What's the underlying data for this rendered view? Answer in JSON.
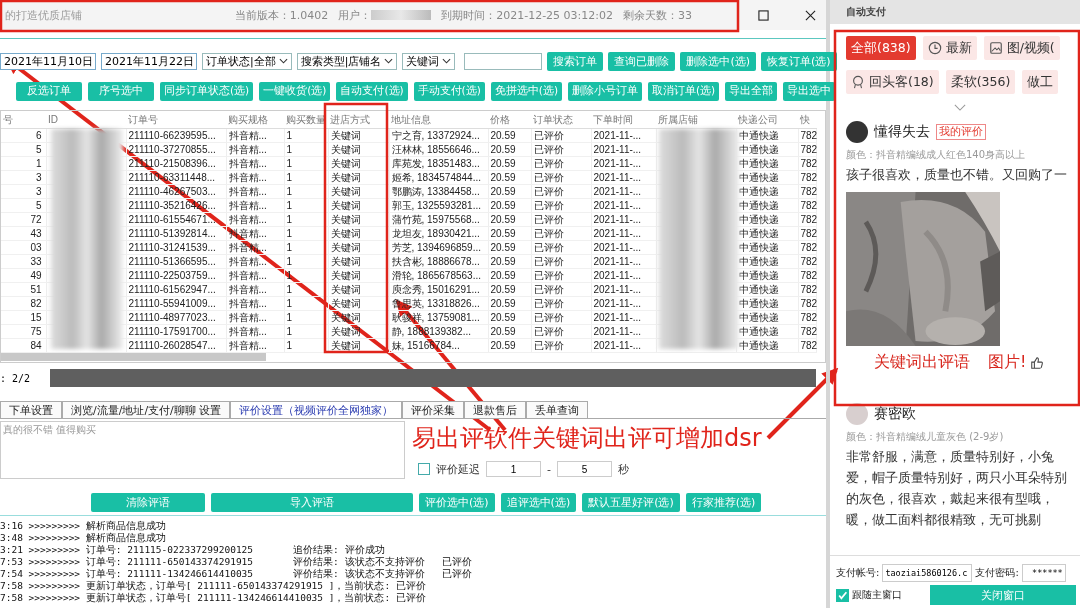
{
  "window": {
    "title": "的打造优质店铺",
    "version": "当前版本：1.0402",
    "user_label": "用户：",
    "expiry": "到期时间：2021-12-25 03:12:02",
    "days_left": "剩余天数：33"
  },
  "filters": [
    {
      "kind": "date",
      "value": "2021年11月10日"
    },
    {
      "kind": "date",
      "value": "2021年11月22日"
    },
    {
      "kind": "select",
      "value": "订单状态|全部"
    },
    {
      "kind": "select",
      "value": "搜索类型|店铺名"
    },
    {
      "kind": "select",
      "value": "关键词"
    },
    {
      "kind": "text"
    }
  ],
  "toolbar_buttons": [
    "搜索订单",
    "查询已删除",
    "删除选中(选)",
    "恢复订单(选)"
  ],
  "action_buttons": [
    "反选订单",
    "序号选中",
    "同步订单状态(选)",
    "一键收货(选)",
    "自动支付(选)",
    "手动支付(选)",
    "免拼选中(选)",
    "删除小号订单",
    "取消订单(选)",
    "导出全部",
    "导出选中"
  ],
  "table": {
    "columns": [
      "号",
      "ID",
      "订单号",
      "购买规格",
      "购买数量",
      "进店方式",
      "地址信息",
      "价格",
      "订单状态",
      "下单时间",
      "所属店铺",
      "快递公司",
      "快"
    ],
    "rows": [
      {
        "no": "6",
        "order": "211110-66239595...",
        "spec": "抖音精...",
        "qty": "1",
        "entry": "关键词",
        "address": "宁之育, 13372924...",
        "price": "20.59",
        "status": "已评价",
        "time": "2021-11-...",
        "courier": "中通快递",
        "tracking": "782"
      },
      {
        "no": "5",
        "order": "211110-37270855...",
        "spec": "抖音精...",
        "qty": "1",
        "entry": "关键词",
        "address": "汪林林, 18556646...",
        "price": "20.59",
        "status": "已评价",
        "time": "2021-11-...",
        "courier": "中通快递",
        "tracking": "782"
      },
      {
        "no": "1",
        "order": "211110-21508396...",
        "spec": "抖音精...",
        "qty": "1",
        "entry": "关键词",
        "address": "库苑发, 18351483...",
        "price": "20.59",
        "status": "已评价",
        "time": "2021-11-...",
        "courier": "中通快递",
        "tracking": "782"
      },
      {
        "no": "3",
        "order": "211110-63311448...",
        "spec": "抖音精...",
        "qty": "1",
        "entry": "关键词",
        "address": "姬希, 1834574844...",
        "price": "20.59",
        "status": "已评价",
        "time": "2021-11-...",
        "courier": "中通快递",
        "tracking": "782"
      },
      {
        "no": "3",
        "order": "211110-46267503...",
        "spec": "抖音精...",
        "qty": "1",
        "entry": "关键词",
        "address": "鄂鹏涛, 13384458...",
        "price": "20.59",
        "status": "已评价",
        "time": "2021-11-...",
        "courier": "中通快递",
        "tracking": "782"
      },
      {
        "no": "5",
        "order": "211110-35216426...",
        "spec": "抖音精...",
        "qty": "1",
        "entry": "关键词",
        "address": "郭玉, 1325593281...",
        "price": "20.59",
        "status": "已评价",
        "time": "2021-11-...",
        "courier": "中通快递",
        "tracking": "782"
      },
      {
        "no": "72",
        "order": "211110-61554671...",
        "spec": "抖音精...",
        "qty": "1",
        "entry": "关键词",
        "address": "蒲竹苑, 15975568...",
        "price": "20.59",
        "status": "已评价",
        "time": "2021-11-...",
        "courier": "中通快递",
        "tracking": "782"
      },
      {
        "no": "43",
        "order": "211110-51392814...",
        "spec": "抖音精...",
        "qty": "1",
        "entry": "关键词",
        "address": "龙坦友, 18930421...",
        "price": "20.59",
        "status": "已评价",
        "time": "2021-11-...",
        "courier": "中通快递",
        "tracking": "782"
      },
      {
        "no": "03",
        "order": "211110-31241539...",
        "spec": "抖音精...",
        "qty": "1",
        "entry": "关键词",
        "address": "芳芝, 1394696859...",
        "price": "20.59",
        "status": "已评价",
        "time": "2021-11-...",
        "courier": "中通快递",
        "tracking": "782"
      },
      {
        "no": "33",
        "order": "211110-51366595...",
        "spec": "抖音精...",
        "qty": "1",
        "entry": "关键词",
        "address": "扶含彬, 18886678...",
        "price": "20.59",
        "status": "已评价",
        "time": "2021-11-...",
        "courier": "中通快递",
        "tracking": "782"
      },
      {
        "no": "49",
        "order": "211110-22503759...",
        "spec": "抖音精...",
        "qty": "1",
        "entry": "关键词",
        "address": "滑轮, 1865678563...",
        "price": "20.59",
        "status": "已评价",
        "time": "2021-11-...",
        "courier": "中通快递",
        "tracking": "782"
      },
      {
        "no": "51",
        "order": "211110-61562947...",
        "spec": "抖音精...",
        "qty": "1",
        "entry": "关键词",
        "address": "庾念秀, 15016291...",
        "price": "20.59",
        "status": "已评价",
        "time": "2021-11-...",
        "courier": "中通快递",
        "tracking": "782"
      },
      {
        "no": "82",
        "order": "211110-55941009...",
        "spec": "抖音精...",
        "qty": "1",
        "entry": "关键词",
        "address": "鲁思英, 13318826...",
        "price": "20.59",
        "status": "已评价",
        "time": "2021-11-...",
        "courier": "中通快递",
        "tracking": "782"
      },
      {
        "no": "15",
        "order": "211110-48977023...",
        "spec": "抖音精...",
        "qty": "1",
        "entry": "关键词",
        "address": "耿骏祥, 13759081...",
        "price": "20.59",
        "status": "已评价",
        "time": "2021-11-...",
        "courier": "中通快递",
        "tracking": "782"
      },
      {
        "no": "75",
        "order": "211110-17591700...",
        "spec": "抖音精...",
        "qty": "1",
        "entry": "关键词",
        "address": "静, 1888139382...",
        "price": "20.59",
        "status": "已评价",
        "time": "2021-11-...",
        "courier": "中通快递",
        "tracking": "782"
      },
      {
        "no": "84",
        "order": "211110-26028547...",
        "spec": "抖音精...",
        "qty": "1",
        "entry": "关键词",
        "address": "妹, 15166784...",
        "price": "20.59",
        "status": "已评价",
        "time": "2021-11-...",
        "courier": "中通快递",
        "tracking": "782"
      }
    ]
  },
  "pager": ": 2/2",
  "tabs": [
    {
      "label": "下单设置",
      "selected": false
    },
    {
      "label": "浏览/流量/地址/支付/聊聊 设置",
      "selected": false
    },
    {
      "label": "评价设置（视频评价全网独家）",
      "selected": true
    },
    {
      "label": "评价采集",
      "selected": false
    },
    {
      "label": "退款售后",
      "selected": false
    },
    {
      "label": "丢单查询",
      "selected": false
    }
  ],
  "review_settings": {
    "placeholder": "真的很不错 值得购买",
    "delay": {
      "label": "评价延迟",
      "checked": false
    },
    "min": "1",
    "separator": "-",
    "max": "5",
    "unit": "秒",
    "buttons": [
      "清除评语",
      "导入评语",
      "评价选中(选)",
      "追评选中(选)",
      "默认五星好评(选)",
      "行家推荐(选)"
    ]
  },
  "log": [
    "3:16 >>>>>>>>> 解析商品信息成功",
    "3:48 >>>>>>>>> 解析商品信息成功",
    "3:21 >>>>>>>>> 订单号: 211115-022337299200125       追价结果: 评价成功",
    "7:53 >>>>>>>>> 订单号: 211111-650143374291915       评价结果: 该状态不支持评价   已评价",
    "7:54 >>>>>>>>> 订单号: 211111-134246614410035       评价结果: 该状态不支持评价   已评价",
    "7:58 >>>>>>>>> 更新订单状态，订单号[ 211111-650143374291915 ]，当前状态: 已评价",
    "7:58 >>>>>>>>> 更新订单状态，订单号[ 211111-134246614410035 ]，当前状态: 已评价"
  ],
  "annotation": "易出评软件关键词出评可增加dsr",
  "side_panel": {
    "title": "自动支付",
    "chips": [
      [
        {
          "kind": "all",
          "label": "全部(838)",
          "selected": true
        },
        {
          "kind": "latest",
          "label": "最新",
          "selected": false
        },
        {
          "kind": "media",
          "label": "图/视频(",
          "selected": false
        }
      ],
      [
        {
          "kind": "returning",
          "label": "回头客(18)",
          "selected": false
        },
        {
          "kind": "tag",
          "label": "柔软(356)",
          "selected": false
        },
        {
          "kind": "tag",
          "label": "做工",
          "selected": false
        }
      ]
    ],
    "reviews": [
      {
        "name": "懂得失去",
        "badge": "我的评价",
        "spec": "颜色：抖音精编绒成人红色140身高以上",
        "lines": [
          "孩子很喜欢，质量也不错。又回购了一"
        ],
        "photo": {
          "kind": "picture"
        },
        "note": "关键词出评语",
        "note_2": "图片!"
      },
      {
        "name": "赛密欧",
        "spec": "颜色：抖音精编绒儿童灰色 (2-9岁)",
        "lines": [
          "非常舒服，满意，质量特别好，小兔",
          "爱，帽子质量特别好，两只小耳朵特别",
          "的灰色，很喜欢，戴起来很有型哦，",
          "暖，做工面料都很精致，无可挑剔"
        ]
      }
    ],
    "account_label": "支付帐号:",
    "account": "taoziai5860126.c",
    "password_label": "支付密码:",
    "password": "******",
    "follow": {
      "label": "跟随主窗口",
      "checked": true
    },
    "close_button": "关闭窗口"
  }
}
